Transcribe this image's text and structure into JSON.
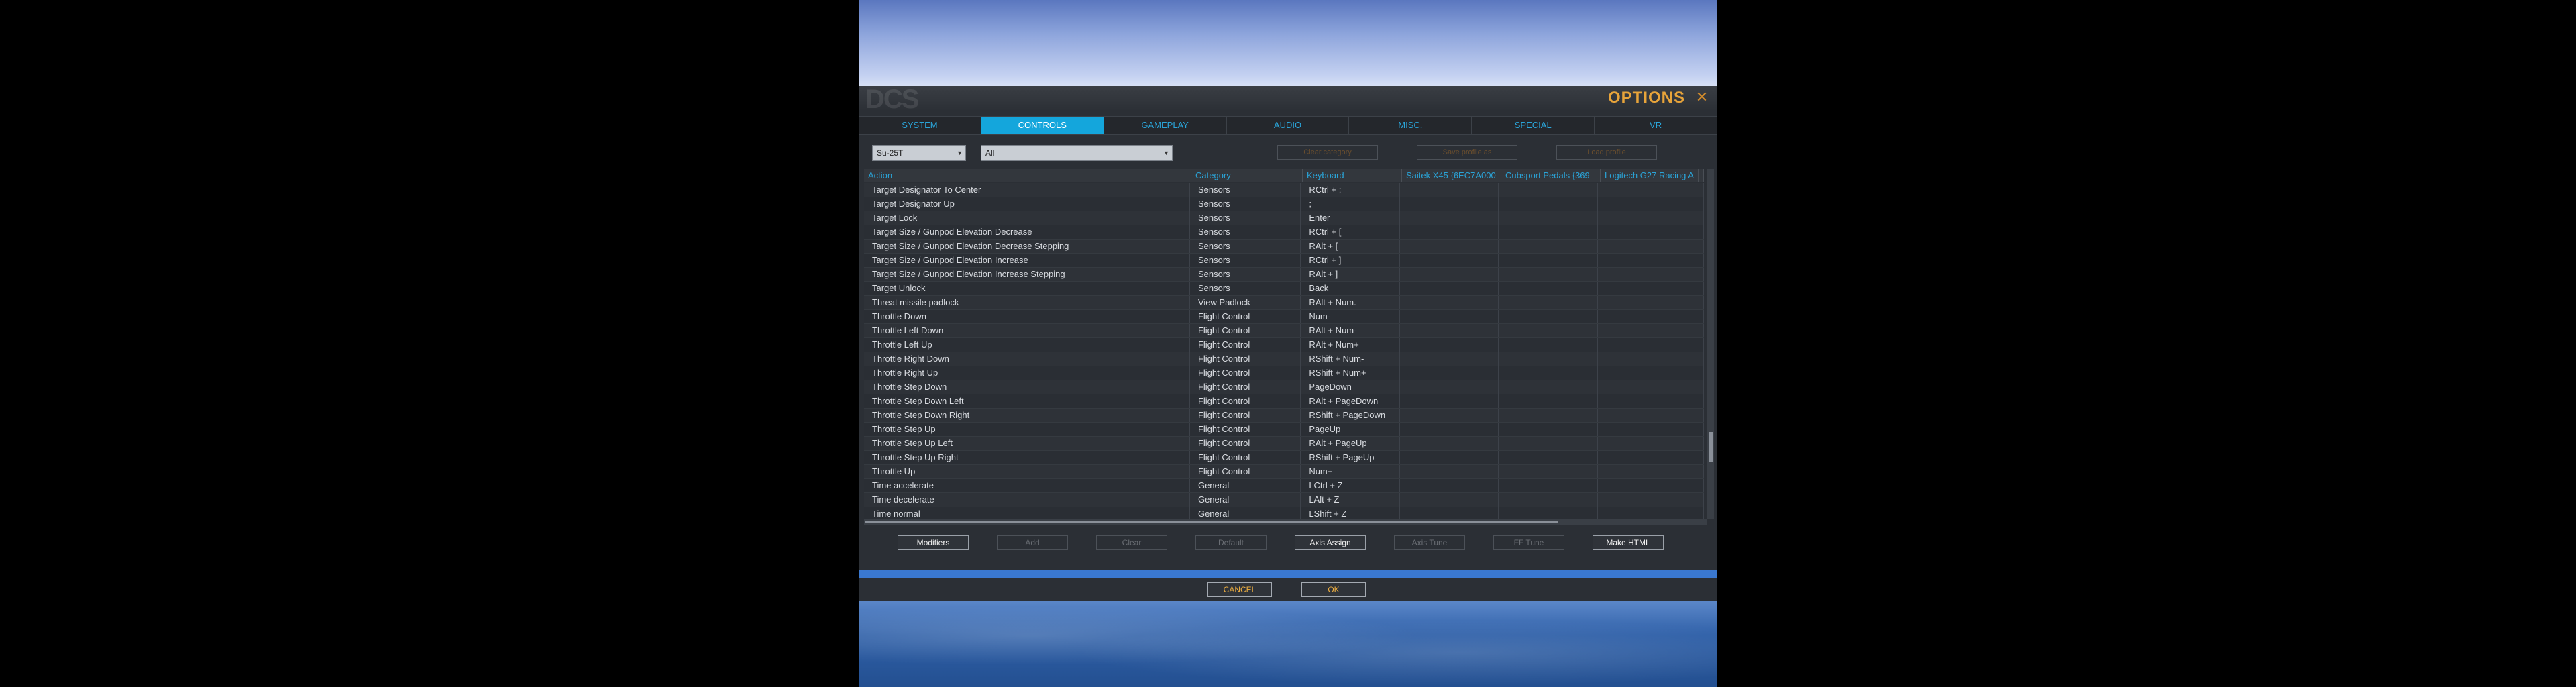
{
  "window": {
    "title": "OPTIONS",
    "logo": "DCS",
    "close_glyph": "✕",
    "accent_color": "#14a6dc",
    "title_color": "#e8a43a"
  },
  "tabs": [
    {
      "label": "SYSTEM",
      "active": false
    },
    {
      "label": "CONTROLS",
      "active": true
    },
    {
      "label": "GAMEPLAY",
      "active": false
    },
    {
      "label": "AUDIO",
      "active": false
    },
    {
      "label": "MISC.",
      "active": false
    },
    {
      "label": "SPECIAL",
      "active": false
    },
    {
      "label": "VR",
      "active": false
    }
  ],
  "filters": {
    "aircraft": "Su-25T",
    "category": "All",
    "clear_category": "Clear category",
    "save_profile_as": "Save profile as",
    "load_profile": "Load profile"
  },
  "table": {
    "headers": [
      "Action",
      "Category",
      "Keyboard",
      "Saitek X45 {6EC7A000",
      "Cubsport Pedals {369",
      "Logitech G27 Racing A"
    ],
    "rows": [
      [
        "Target Designator To Center",
        "Sensors",
        "RCtrl + ;"
      ],
      [
        "Target Designator Up",
        "Sensors",
        ";"
      ],
      [
        "Target Lock",
        "Sensors",
        "Enter"
      ],
      [
        "Target Size / Gunpod Elevation Decrease",
        "Sensors",
        "RCtrl + ["
      ],
      [
        "Target Size / Gunpod Elevation Decrease Stepping",
        "Sensors",
        "RAlt + ["
      ],
      [
        "Target Size / Gunpod Elevation Increase",
        "Sensors",
        "RCtrl + ]"
      ],
      [
        "Target Size / Gunpod Elevation Increase Stepping",
        "Sensors",
        "RAlt + ]"
      ],
      [
        "Target Unlock",
        "Sensors",
        "Back"
      ],
      [
        "Threat missile padlock",
        "View Padlock",
        "RAlt + Num."
      ],
      [
        "Throttle Down",
        "Flight Control",
        "Num-"
      ],
      [
        "Throttle Left Down",
        "Flight Control",
        "RAlt + Num-"
      ],
      [
        "Throttle Left Up",
        "Flight Control",
        "RAlt + Num+"
      ],
      [
        "Throttle Right Down",
        "Flight Control",
        "RShift + Num-"
      ],
      [
        "Throttle Right Up",
        "Flight Control",
        "RShift + Num+"
      ],
      [
        "Throttle Step Down",
        "Flight Control",
        "PageDown"
      ],
      [
        "Throttle Step Down Left",
        "Flight Control",
        "RAlt + PageDown"
      ],
      [
        "Throttle Step Down Right",
        "Flight Control",
        "RShift + PageDown"
      ],
      [
        "Throttle Step Up",
        "Flight Control",
        "PageUp"
      ],
      [
        "Throttle Step Up Left",
        "Flight Control",
        "RAlt + PageUp"
      ],
      [
        "Throttle Step Up Right",
        "Flight Control",
        "RShift + PageUp"
      ],
      [
        "Throttle Up",
        "Flight Control",
        "Num+"
      ],
      [
        "Time accelerate",
        "General",
        "LCtrl + Z"
      ],
      [
        "Time decelerate",
        "General",
        "LAlt + Z"
      ],
      [
        "Time normal",
        "General",
        "LShift + Z"
      ]
    ]
  },
  "actions": {
    "modifiers": "Modifiers",
    "add": "Add",
    "clear": "Clear",
    "default": "Default",
    "axis_assign": "Axis Assign",
    "axis_tune": "Axis Tune",
    "ff_tune": "FF Tune",
    "make_html": "Make HTML"
  },
  "footer": {
    "cancel": "CANCEL",
    "ok": "OK"
  }
}
